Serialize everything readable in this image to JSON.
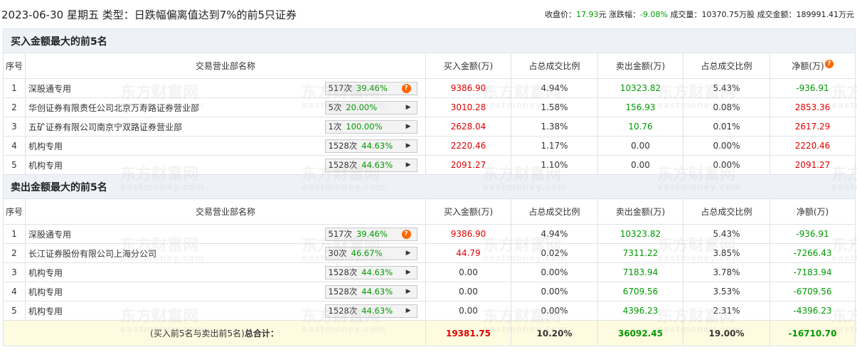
{
  "header": {
    "title": "2023-06-30 星期五 类型：日跌幅偏离值达到7%的前5只证券",
    "close_label": "收盘价：",
    "close_value": "17.93",
    "close_unit": "元",
    "change_label": "涨跌幅：",
    "change_value": "-9.08%",
    "volume_label": "成交量：",
    "volume_value": "10370.75万股",
    "turnover_label": "成交金额：",
    "turnover_value": "189991.41万元"
  },
  "columns": {
    "seq": "序号",
    "name": "交易营业部名称",
    "buy": "买入金额(万)",
    "buy_ratio": "占总成交比例",
    "sell": "卖出金额(万)",
    "sell_ratio": "占总成交比例",
    "net": "净额(万)"
  },
  "buy_section": {
    "title": "买入金额最大的前5名",
    "rows": [
      {
        "seq": "1",
        "name": "深股通专用",
        "times": "517次",
        "pct": "39.46%",
        "icon": "question-icon",
        "buy": "9386.90",
        "buy_ratio": "4.94%",
        "sell": "10323.82",
        "sell_ratio": "5.43%",
        "net": "-936.91"
      },
      {
        "seq": "2",
        "name": "华创证券有限责任公司北京万寿路证券营业部",
        "times": "5次",
        "pct": "20.00%",
        "icon": "play-icon",
        "buy": "3010.28",
        "buy_ratio": "1.58%",
        "sell": "156.93",
        "sell_ratio": "0.08%",
        "net": "2853.36"
      },
      {
        "seq": "3",
        "name": "五矿证券有限公司南京宁双路证券营业部",
        "times": "1次",
        "pct": "100.00%",
        "icon": "play-icon",
        "buy": "2628.04",
        "buy_ratio": "1.38%",
        "sell": "10.76",
        "sell_ratio": "0.01%",
        "net": "2617.29"
      },
      {
        "seq": "4",
        "name": "机构专用",
        "times": "1528次",
        "pct": "44.63%",
        "icon": "play-icon",
        "buy": "2220.46",
        "buy_ratio": "1.17%",
        "sell": "0.00",
        "sell_ratio": "0.00%",
        "net": "2220.46"
      },
      {
        "seq": "5",
        "name": "机构专用",
        "times": "1528次",
        "pct": "44.63%",
        "icon": "play-icon",
        "buy": "2091.27",
        "buy_ratio": "1.10%",
        "sell": "0.00",
        "sell_ratio": "0.00%",
        "net": "2091.27"
      }
    ]
  },
  "sell_section": {
    "title": "卖出金额最大的前5名",
    "rows": [
      {
        "seq": "1",
        "name": "深股通专用",
        "times": "517次",
        "pct": "39.46%",
        "icon": "question-icon",
        "buy": "9386.90",
        "buy_ratio": "4.94%",
        "sell": "10323.82",
        "sell_ratio": "5.43%",
        "net": "-936.91"
      },
      {
        "seq": "2",
        "name": "长江证券股份有限公司上海分公司",
        "times": "30次",
        "pct": "46.67%",
        "icon": "play-icon",
        "buy": "44.79",
        "buy_ratio": "0.02%",
        "sell": "7311.22",
        "sell_ratio": "3.85%",
        "net": "-7266.43"
      },
      {
        "seq": "3",
        "name": "机构专用",
        "times": "1528次",
        "pct": "44.63%",
        "icon": "play-icon",
        "buy": "0.00",
        "buy_ratio": "0.00%",
        "sell": "7183.94",
        "sell_ratio": "3.78%",
        "net": "-7183.94"
      },
      {
        "seq": "4",
        "name": "机构专用",
        "times": "1528次",
        "pct": "44.63%",
        "icon": "play-icon",
        "buy": "0.00",
        "buy_ratio": "0.00%",
        "sell": "6709.56",
        "sell_ratio": "3.53%",
        "net": "-6709.56"
      },
      {
        "seq": "5",
        "name": "机构专用",
        "times": "1528次",
        "pct": "44.63%",
        "icon": "play-icon",
        "buy": "0.00",
        "buy_ratio": "0.00%",
        "sell": "4396.23",
        "sell_ratio": "2.31%",
        "net": "-4396.23"
      }
    ]
  },
  "total": {
    "label_prefix": "(买入前5名与卖出前5名)",
    "label_bold": "总合计：",
    "buy": "19381.75",
    "buy_ratio": "10.20%",
    "sell": "36092.45",
    "sell_ratio": "19.00%",
    "net": "-16710.70"
  },
  "watermark": {
    "cn": "东方财富网",
    "en": "eastmoney.com"
  },
  "colors": {
    "up": "#e00000",
    "down": "#009900",
    "section_bg": "#eef2f7",
    "total_bg": "#fffbe0",
    "help_icon": "#ff6600"
  }
}
